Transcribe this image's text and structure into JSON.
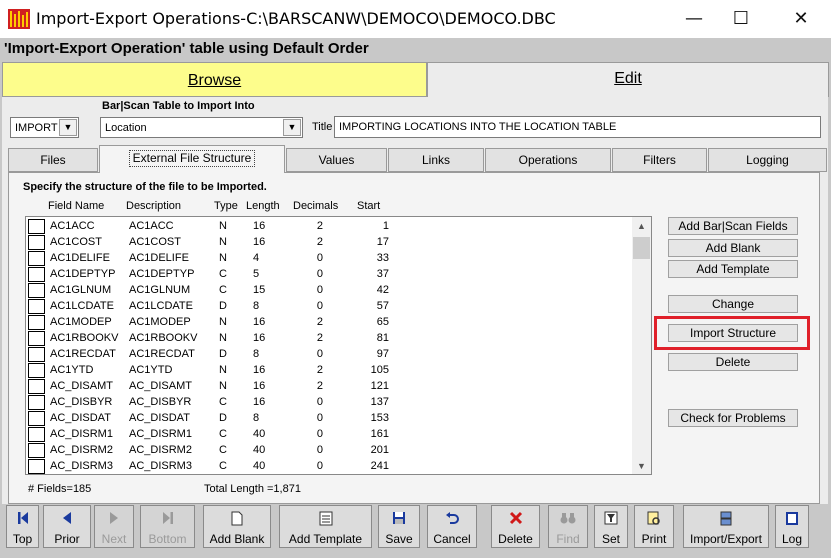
{
  "window": {
    "title": "Import-Export Operations-C:\\BARSCANW\\DEMOCO\\DEMOCO.DBC",
    "minimize": "—",
    "maximize": "☐",
    "close": "✕"
  },
  "caption": "'Import-Export Operation' table using Default Order",
  "mode_tabs": {
    "browse": "Browse",
    "edit": "Edit"
  },
  "form": {
    "operation": "IMPORT",
    "import_label": "Bar|Scan Table to Import Into",
    "table": "Location",
    "title_label": "Title",
    "title_value": "IMPORTING LOCATIONS INTO THE LOCATION TABLE"
  },
  "tabs": [
    "Files",
    "External File Structure",
    "Values",
    "Links",
    "Operations",
    "Filters",
    "Logging"
  ],
  "panel": {
    "instruction": "Specify the structure of the file to be Imported.",
    "columns": [
      "Field Name",
      "Description",
      "Type",
      "Length",
      "Decimals",
      "Start"
    ],
    "rows": [
      [
        "AC1ACC",
        "AC1ACC",
        "N",
        "16",
        "2",
        "1"
      ],
      [
        "AC1COST",
        "AC1COST",
        "N",
        "16",
        "2",
        "17"
      ],
      [
        "AC1DELIFE",
        "AC1DELIFE",
        "N",
        "4",
        "0",
        "33"
      ],
      [
        "AC1DEPTYP",
        "AC1DEPTYP",
        "C",
        "5",
        "0",
        "37"
      ],
      [
        "AC1GLNUM",
        "AC1GLNUM",
        "C",
        "15",
        "0",
        "42"
      ],
      [
        "AC1LCDATE",
        "AC1LCDATE",
        "D",
        "8",
        "0",
        "57"
      ],
      [
        "AC1MODEP",
        "AC1MODEP",
        "N",
        "16",
        "2",
        "65"
      ],
      [
        "AC1RBOOKV",
        "AC1RBOOKV",
        "N",
        "16",
        "2",
        "81"
      ],
      [
        "AC1RECDAT",
        "AC1RECDAT",
        "D",
        "8",
        "0",
        "97"
      ],
      [
        "AC1YTD",
        "AC1YTD",
        "N",
        "16",
        "2",
        "105"
      ],
      [
        "AC_DISAMT",
        "AC_DISAMT",
        "N",
        "16",
        "2",
        "121"
      ],
      [
        "AC_DISBYR",
        "AC_DISBYR",
        "C",
        "16",
        "0",
        "137"
      ],
      [
        "AC_DISDAT",
        "AC_DISDAT",
        "D",
        "8",
        "0",
        "153"
      ],
      [
        "AC_DISRM1",
        "AC_DISRM1",
        "C",
        "40",
        "0",
        "161"
      ],
      [
        "AC_DISRM2",
        "AC_DISRM2",
        "C",
        "40",
        "0",
        "201"
      ],
      [
        "AC_DISRM3",
        "AC_DISRM3",
        "C",
        "40",
        "0",
        "241"
      ]
    ],
    "fields_count": "# Fields=185",
    "total_length": "Total Length =1,871"
  },
  "side_buttons": {
    "add_fields": "Add Bar|Scan Fields",
    "add_blank": "Add Blank",
    "add_template": "Add Template",
    "change": "Change",
    "import_structure": "Import Structure",
    "delete": "Delete",
    "check_problems": "Check for Problems"
  },
  "toolbar": {
    "top": "Top",
    "prior": "Prior",
    "next": "Next",
    "bottom": "Bottom",
    "add_blank": "Add Blank",
    "add_template": "Add Template",
    "save": "Save",
    "cancel": "Cancel",
    "delete": "Delete",
    "find": "Find",
    "set": "Set",
    "print": "Print",
    "import_export": "Import/Export",
    "log": "Log"
  },
  "colors": {
    "browse_tab": "#fdfd8c",
    "highlight": "#e0202a",
    "nav_icon": "#1a3a9e",
    "delete_icon": "#d01818"
  }
}
